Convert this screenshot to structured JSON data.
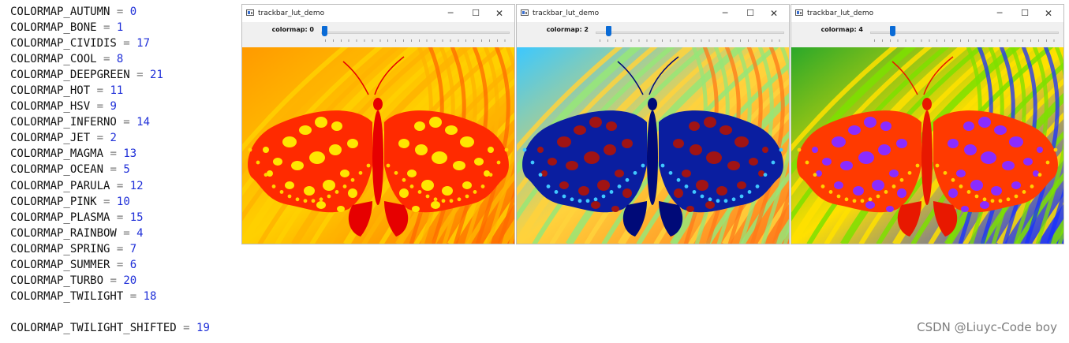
{
  "code_list": {
    "lines": [
      {
        "name": "COLORMAP_AUTUMN",
        "op": "=",
        "value": "0"
      },
      {
        "name": "COLORMAP_BONE",
        "op": "=",
        "value": "1"
      },
      {
        "name": "COLORMAP_CIVIDIS",
        "op": "=",
        "value": "17"
      },
      {
        "name": "COLORMAP_COOL",
        "op": "=",
        "value": "8"
      },
      {
        "name": "COLORMAP_DEEPGREEN",
        "op": "=",
        "value": "21"
      },
      {
        "name": "COLORMAP_HOT",
        "op": "=",
        "value": "11"
      },
      {
        "name": "COLORMAP_HSV",
        "op": "=",
        "value": "9"
      },
      {
        "name": "COLORMAP_INFERNO",
        "op": "=",
        "value": "14"
      },
      {
        "name": "COLORMAP_JET",
        "op": "=",
        "value": "2"
      },
      {
        "name": "COLORMAP_MAGMA",
        "op": "=",
        "value": "13"
      },
      {
        "name": "COLORMAP_OCEAN",
        "op": "=",
        "value": "5"
      },
      {
        "name": "COLORMAP_PARULA",
        "op": "=",
        "value": "12"
      },
      {
        "name": "COLORMAP_PINK",
        "op": "=",
        "value": "10"
      },
      {
        "name": "COLORMAP_PLASMA",
        "op": "=",
        "value": "15"
      },
      {
        "name": "COLORMAP_RAINBOW",
        "op": "=",
        "value": "4"
      },
      {
        "name": "COLORMAP_SPRING",
        "op": "=",
        "value": "7"
      },
      {
        "name": "COLORMAP_SUMMER",
        "op": "=",
        "value": "6"
      },
      {
        "name": "COLORMAP_TURBO",
        "op": "=",
        "value": "20"
      },
      {
        "name": "COLORMAP_TWILIGHT",
        "op": "=",
        "value": "18"
      }
    ],
    "last_line": {
      "name": "COLORMAP_TWILIGHT_SHIFTED",
      "op": "=",
      "value": "19"
    }
  },
  "windows": [
    {
      "title": "trackbar_lut_demo",
      "trackbar_label": "colormap: 0",
      "slider_fraction": 0.0,
      "colormap": "autumn",
      "palette": {
        "bg1": "#ff9a00",
        "bg2": "#ffd000",
        "bg3": "#ff6a00",
        "stripe": "#ffb300",
        "body": "#ff2a00",
        "body_dark": "#e60000",
        "spot": "#ffe600",
        "edge": "#ffd400"
      }
    },
    {
      "title": "trackbar_lut_demo",
      "trackbar_label": "colormap: 2",
      "slider_fraction": 0.1,
      "colormap": "jet",
      "palette": {
        "bg1": "#3cc8ff",
        "bg2": "#ffd23c",
        "bg3": "#ff7a1a",
        "stripe": "#96e678",
        "body": "#0a1ea0",
        "body_dark": "#000a78",
        "spot": "#a01414",
        "edge": "#40c8ff"
      }
    },
    {
      "title": "trackbar_lut_demo",
      "trackbar_label": "colormap: 4",
      "slider_fraction": 0.2,
      "colormap": "rainbow",
      "palette": {
        "bg1": "#2aa82a",
        "bg2": "#ffe000",
        "bg3": "#1830ff",
        "stripe": "#7ce000",
        "body": "#ff3a00",
        "body_dark": "#e81800",
        "spot": "#8a2cff",
        "edge": "#ffd000"
      }
    }
  ],
  "window_controls": {
    "minimize": "─",
    "maximize": "☐",
    "close": "✕"
  },
  "watermark": "CSDN @Liuyc-Code boy"
}
